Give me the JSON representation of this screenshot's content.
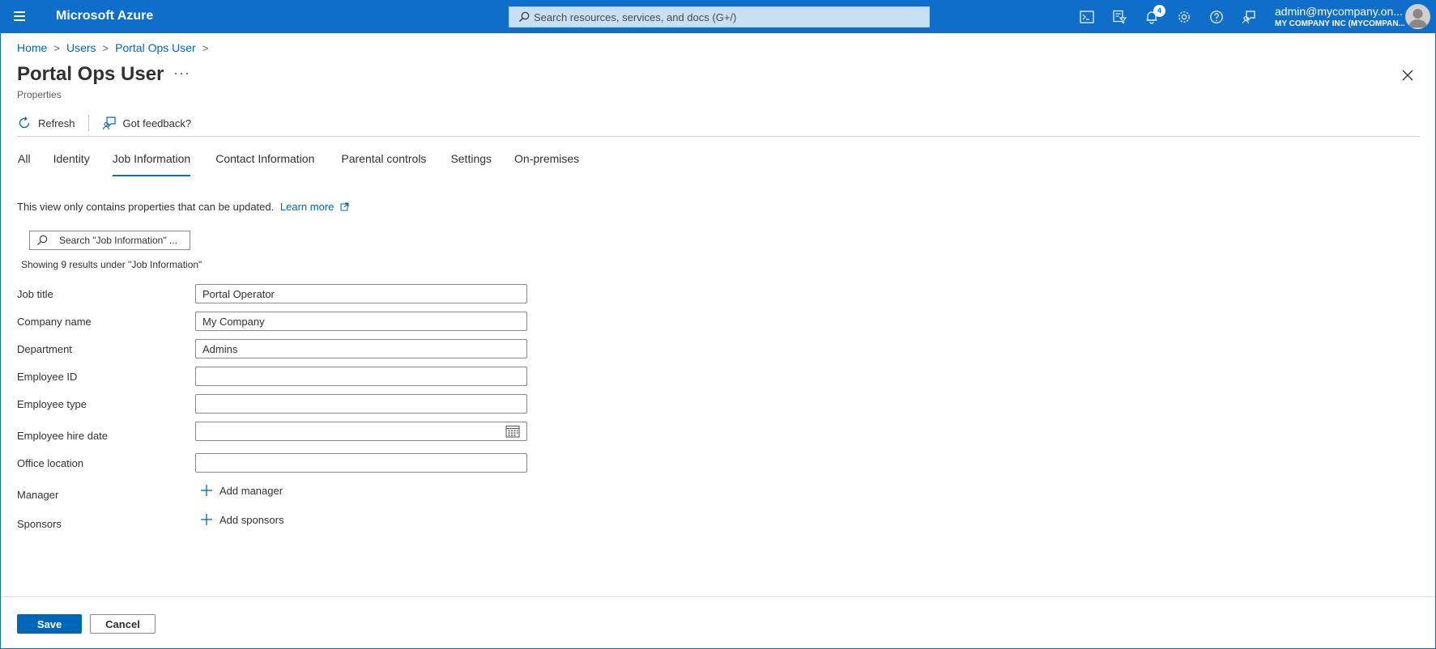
{
  "topbar": {
    "brand": "Microsoft Azure",
    "search_placeholder": "Search resources, services, and docs (G+/)",
    "notification_count": "4",
    "icons": [
      "cloud-shell-icon",
      "directory-filter-icon",
      "notifications-icon",
      "settings-icon",
      "help-icon",
      "feedback-icon"
    ],
    "account_name": "admin@mycompany.on...",
    "account_org": "MY COMPANY INC (MYCOMPAN..."
  },
  "breadcrumb": [
    "Home",
    "Users",
    "Portal Ops User"
  ],
  "page": {
    "title": "Portal Ops User",
    "more": "···",
    "subtitle": "Properties"
  },
  "toolbar": {
    "refresh": "Refresh",
    "feedback": "Got feedback?"
  },
  "tabs": [
    {
      "label": "All",
      "active": false
    },
    {
      "label": "Identity",
      "active": false
    },
    {
      "label": "Job Information",
      "active": true
    },
    {
      "label": "Contact Information",
      "active": false
    },
    {
      "label": "Parental controls",
      "active": false
    },
    {
      "label": "Settings",
      "active": false
    },
    {
      "label": "On-premises",
      "active": false
    }
  ],
  "info": {
    "text": "This view only contains properties that can be updated.",
    "link": "Learn more"
  },
  "filter": {
    "placeholder": "Search \"Job Information\" ...",
    "results": "Showing 9 results under \"Job Information\""
  },
  "fields": {
    "job_title": {
      "label": "Job title",
      "value": "Portal Operator"
    },
    "company_name": {
      "label": "Company name",
      "value": "My Company"
    },
    "department": {
      "label": "Department",
      "value": "Admins"
    },
    "employee_id": {
      "label": "Employee ID",
      "value": ""
    },
    "employee_type": {
      "label": "Employee type",
      "value": ""
    },
    "employee_hire_date": {
      "label": "Employee hire date",
      "value": ""
    },
    "office_location": {
      "label": "Office location",
      "value": ""
    },
    "manager": {
      "label": "Manager",
      "action": "Add manager"
    },
    "sponsors": {
      "label": "Sponsors",
      "action": "Add sponsors"
    }
  },
  "footer": {
    "save": "Save",
    "cancel": "Cancel"
  },
  "colors": {
    "topbar": "#0f6ec9",
    "accent": "#0067b8"
  }
}
